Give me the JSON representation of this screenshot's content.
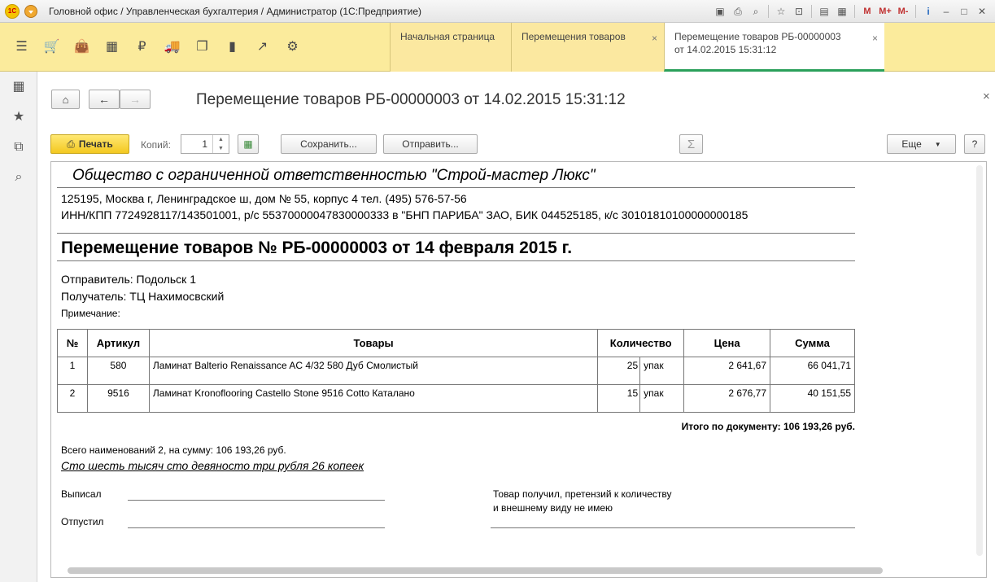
{
  "window": {
    "title": "Головной офис / Управленческая бухгалтерия / Администратор  (1С:Предприятие)",
    "logo_text": "1С",
    "tools": {
      "m": "M",
      "m_plus": "M+",
      "m_minus": "M-",
      "info": "i"
    }
  },
  "sections": [
    {
      "name": "menu",
      "glyph": "☰"
    },
    {
      "name": "sales",
      "glyph": "🛒"
    },
    {
      "name": "purchases",
      "glyph": "👜"
    },
    {
      "name": "warehouse",
      "glyph": "▦"
    },
    {
      "name": "money",
      "glyph": "₽"
    },
    {
      "name": "delivery",
      "glyph": "🚚"
    },
    {
      "name": "documents",
      "glyph": "❐"
    },
    {
      "name": "reports",
      "glyph": "▮"
    },
    {
      "name": "analytics",
      "glyph": "↗"
    },
    {
      "name": "settings",
      "glyph": "⚙"
    }
  ],
  "tabs": [
    {
      "label": "Начальная страница",
      "active": false
    },
    {
      "label": "Перемещения товаров",
      "active": false,
      "closable": true
    },
    {
      "label_line1": "Перемещение товаров РБ-00000003",
      "label_line2": "от 14.02.2015 15:31:12",
      "active": true,
      "closable": true
    }
  ],
  "leftnav": {
    "apps": "▦",
    "favorites": "★",
    "history": "⧉",
    "search": "⌕"
  },
  "form": {
    "title": "Перемещение товаров РБ-00000003 от 14.02.2015 15:31:12",
    "print_label": "Печать",
    "copies_label": "Копий:",
    "copies_value": "1",
    "save_label": "Сохранить...",
    "send_label": "Отправить...",
    "sum_label": "Σ",
    "more_label": "Еще",
    "help_label": "?"
  },
  "doc": {
    "org_name": "Общество с ограниченной ответственностью \"Строй-мастер Люкс\"",
    "address": "125195, Москва г, Ленинградское ш, дом № 55, корпус 4 тел. (495) 576-57-56",
    "requisites": "ИНН/КПП 7724928117/143501001, р/с 55370000047830000333 в \"БНП ПАРИБА\" ЗАО, БИК 044525185, к/с 30101810100000000185",
    "title": "Перемещение товаров № РБ-00000003 от 14 февраля 2015 г.",
    "sender": "Отправитель: Подольск 1",
    "receiver": "Получатель: ТЦ Нахимосвский",
    "note": "Примечание:",
    "columns": {
      "num": "№",
      "article": "Артикул",
      "goods": "Товары",
      "qty": "Количество",
      "price": "Цена",
      "sum": "Сумма"
    },
    "rows": [
      {
        "num": "1",
        "article": "580",
        "goods": "Ламинат Balterio Renaissance AC 4/32 580 Дуб Смолистый",
        "qty": "25",
        "unit": "упак",
        "price": "2 641,67",
        "sum": "66 041,71"
      },
      {
        "num": "2",
        "article": "9516",
        "goods": "Ламинат Kronoflooring Castello Stone 9516 Cotto Каталано",
        "qty": "15",
        "unit": "упак",
        "price": "2 676,77",
        "sum": "40 151,55"
      }
    ],
    "total": "Итого по документу:  106 193,26 руб.",
    "count_summary": "Всего наименований 2, на сумму:  106 193,26 руб.",
    "sum_words": "Сто шесть тысяч сто девяносто три рубля 26 копеек",
    "issued": "Выписал",
    "released": "Отпустил",
    "received_line1": "Товар получил, претензий к количеству",
    "received_line2": "и внешнему виду не имею"
  }
}
